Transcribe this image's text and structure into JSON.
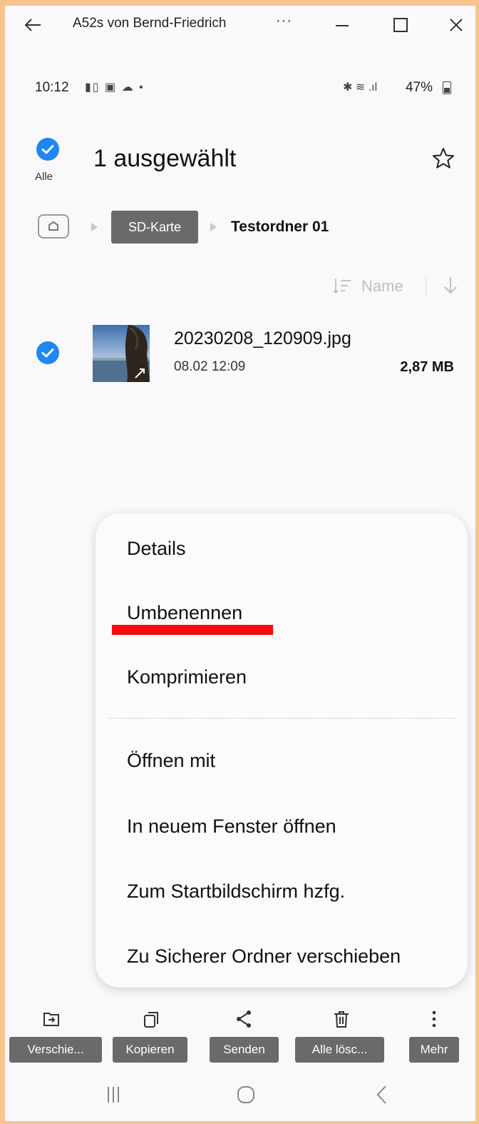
{
  "window": {
    "title": "A52s von Bernd-Friedrich",
    "more": "···"
  },
  "status": {
    "time": "10:12",
    "notif_icons": "▮▯ ▣ ☁ •",
    "sys_icons": "✱ ≋ .ıl",
    "battery": "47%"
  },
  "header": {
    "select_all_label": "Alle",
    "title": "1 ausgewählt"
  },
  "breadcrumb": {
    "sd_card": "SD-Karte",
    "current": "Testordner 01"
  },
  "sort": {
    "label": "Name"
  },
  "file": {
    "name": "20230208_120909.jpg",
    "date": "08.02 12:09",
    "size": "2,87 MB"
  },
  "menu": {
    "items": [
      "Details",
      "Umbenennen",
      "Komprimieren",
      "Öffnen mit",
      "In neuem Fenster öffnen",
      "Zum Startbildschirm hzfg.",
      "Zu Sicherer Ordner verschieben"
    ]
  },
  "toolbar": {
    "items": [
      {
        "label": "Verschie...",
        "icon": "move-icon"
      },
      {
        "label": "Kopieren",
        "icon": "copy-icon"
      },
      {
        "label": "Senden",
        "icon": "share-icon"
      },
      {
        "label": "Alle lösc...",
        "icon": "trash-icon"
      },
      {
        "label": "Mehr",
        "icon": "more-vertical-icon"
      }
    ]
  },
  "colors": {
    "accent": "#1e86f5",
    "annotation": "#f40b0b",
    "frame": "#f6c48c",
    "label_bg": "#6a6a6a"
  }
}
